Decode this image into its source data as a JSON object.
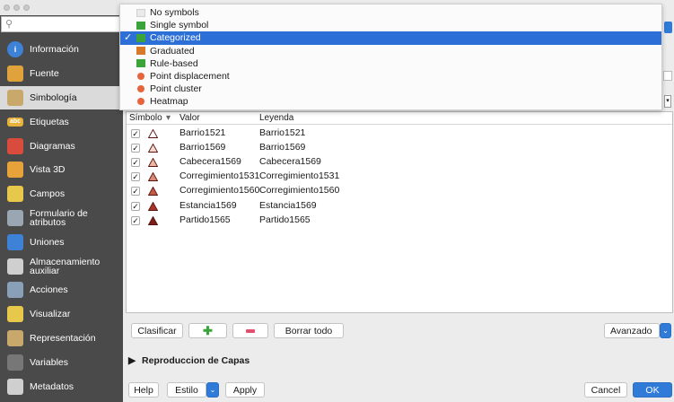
{
  "sidebar": {
    "search_placeholder": "",
    "items": [
      {
        "label": "Información",
        "icon": "info-icon",
        "color": "#3d82d6"
      },
      {
        "label": "Fuente",
        "icon": "source-icon",
        "color": "#e0a23a"
      },
      {
        "label": "Simbología",
        "icon": "paintbrush-icon",
        "color": "#c9a96b"
      },
      {
        "label": "Etiquetas",
        "icon": "labels-icon",
        "color": "#e8b13a"
      },
      {
        "label": "Diagramas",
        "icon": "diagram-icon",
        "color": "#d94c3d"
      },
      {
        "label": "Vista 3D",
        "icon": "cube-icon",
        "color": "#e8a23a"
      },
      {
        "label": "Campos",
        "icon": "fields-icon",
        "color": "#e8c84a"
      },
      {
        "label": "Formulario de atributos",
        "icon": "form-icon",
        "color": "#9aa6b2"
      },
      {
        "label": "Uniones",
        "icon": "join-icon",
        "color": "#3d82d6"
      },
      {
        "label": "Almacenamiento auxiliar",
        "icon": "storage-icon",
        "color": "#cfcfcf"
      },
      {
        "label": "Acciones",
        "icon": "gear-icon",
        "color": "#8aa0b8"
      },
      {
        "label": "Visualizar",
        "icon": "speech-bubble-icon",
        "color": "#e8c84a"
      },
      {
        "label": "Representación",
        "icon": "brush-icon",
        "color": "#c9a96b"
      },
      {
        "label": "Variables",
        "icon": "variables-icon",
        "color": "#777777"
      },
      {
        "label": "Metadatos",
        "icon": "metadata-icon",
        "color": "#cfcfcf"
      }
    ]
  },
  "dropdown": {
    "items": [
      {
        "label": "No symbols",
        "icon": "no-symbols-icon",
        "selected": false
      },
      {
        "label": "Single symbol",
        "icon": "single-symbol-icon",
        "selected": false
      },
      {
        "label": "Categorized",
        "icon": "categorized-icon",
        "selected": true
      },
      {
        "label": "Graduated",
        "icon": "graduated-icon",
        "selected": false
      },
      {
        "label": "Rule-based",
        "icon": "rule-based-icon",
        "selected": false
      },
      {
        "label": "Point displacement",
        "icon": "point-displacement-icon",
        "selected": false
      },
      {
        "label": "Point cluster",
        "icon": "point-cluster-icon",
        "selected": false
      },
      {
        "label": "Heatmap",
        "icon": "heatmap-icon",
        "selected": false
      }
    ]
  },
  "table": {
    "headers": {
      "symbol": "Símbolo",
      "value": "Valor",
      "legend": "Leyenda"
    },
    "rows": [
      {
        "checked": "✓",
        "value": "Barrio1521",
        "legend": "Barrio1521",
        "color": "#ffffff"
      },
      {
        "checked": "✓",
        "value": "Barrio1569",
        "legend": "Barrio1569",
        "color": "#f3d8cf"
      },
      {
        "checked": "✓",
        "value": "Cabecera1569",
        "legend": "Cabecera1569",
        "color": "#ebb8a6"
      },
      {
        "checked": "✓",
        "value": "Corregimiento1531",
        "legend": "Corregimiento1531",
        "color": "#d98a72"
      },
      {
        "checked": "✓",
        "value": "Corregimiento1560",
        "legend": "Corregimiento1560",
        "color": "#c25a44"
      },
      {
        "checked": "✓",
        "value": "Estancia1569",
        "legend": "Estancia1569",
        "color": "#a7352a"
      },
      {
        "checked": "✓",
        "value": "Partido1565",
        "legend": "Partido1565",
        "color": "#7e1e18"
      }
    ]
  },
  "buttons": {
    "classify": "Clasificar",
    "delete_all": "Borrar todo",
    "advanced": "Avanzado",
    "help": "Help",
    "style": "Estilo",
    "apply": "Apply",
    "cancel": "Cancel",
    "ok": "OK"
  },
  "section": {
    "title": "Reproduccion de Capas"
  },
  "colors": {
    "accent": "#2f7bd7",
    "sidebar_bg": "#4a4a4a",
    "selected_item": "#2c6fd6"
  }
}
